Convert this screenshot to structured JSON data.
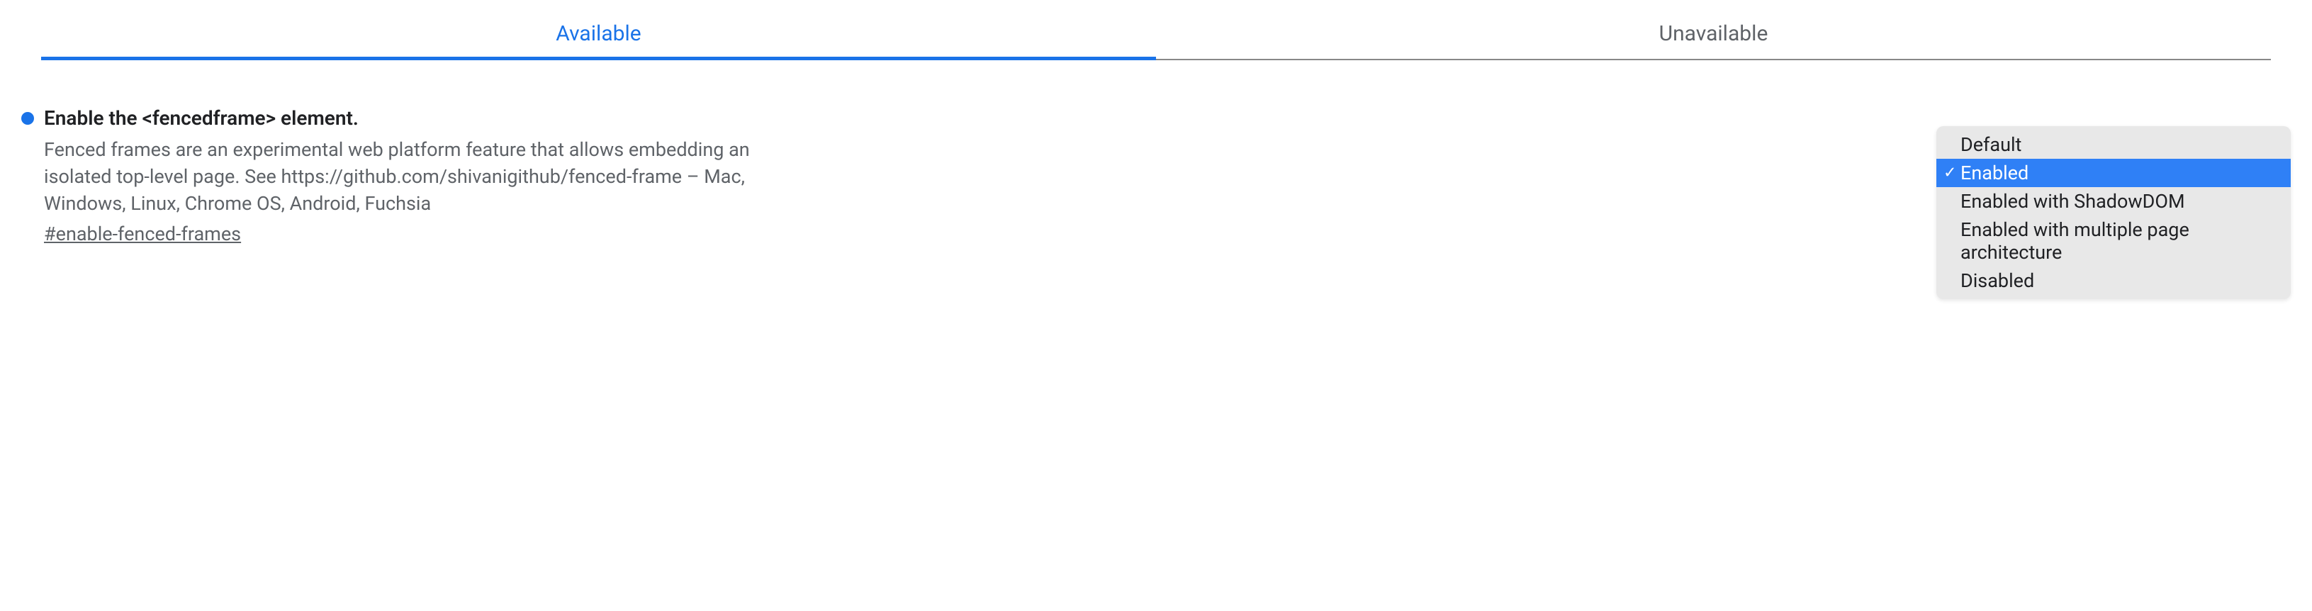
{
  "tabs": {
    "available": "Available",
    "unavailable": "Unavailable"
  },
  "flag": {
    "title": "Enable the <fencedframe> element.",
    "description": "Fenced frames are an experimental web platform feature that allows embedding an isolated top-level page. See https://github.com/shivanigithub/fenced-frame – Mac, Windows, Linux, Chrome OS, Android, Fuchsia",
    "hash": "#enable-fenced-frames",
    "status_color": "#1a73e8"
  },
  "dropdown": {
    "options": [
      "Default",
      "Enabled",
      "Enabled with ShadowDOM",
      "Enabled with multiple page architecture",
      "Disabled"
    ],
    "selected_index": 1
  }
}
